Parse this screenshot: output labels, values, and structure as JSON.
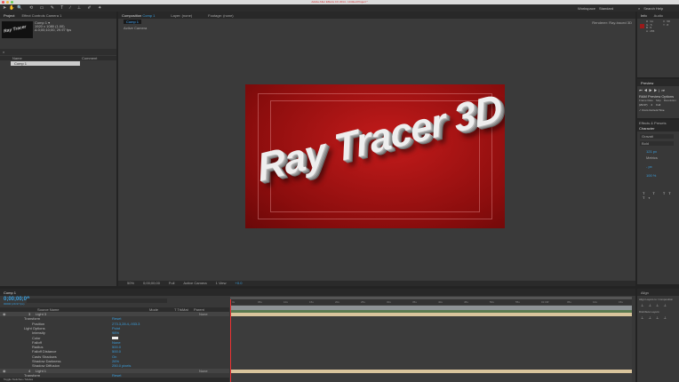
{
  "window": {
    "title": "Adobe After Effects CC 2014 - Untitled Project *"
  },
  "workspace": {
    "label": "Workspace",
    "value": "Standard",
    "search_placeholder": "Search Help"
  },
  "project": {
    "tab": "Project",
    "effect_controls_tab": "Effect Controls Camera 1",
    "comp_name": "Comp 1 ▾",
    "comp_info_1": "1920 x 1080 (1.00)",
    "comp_info_2": "Δ 0;00;10;00, 29.97 fps",
    "thumb_text": "Ray Tracer",
    "col_name": "Name",
    "col_comment": "Comment",
    "item": "Comp 1"
  },
  "composition": {
    "tab_prefix": "Composition",
    "tab_comp": "Comp 1",
    "layer_tab": "Layer: (none)",
    "footage_tab": "Footage: (none)",
    "comp_chip": "Comp 1",
    "camera_label": "Active Camera",
    "renderer_label": "Renderer:",
    "renderer_value": "Ray-traced 3D",
    "title_text": "Ray Tracer 3D",
    "footer": {
      "zoom": "50%",
      "timecode": "0;00;00;00",
      "resolution": "Full",
      "camera": "Active Camera",
      "view": "1 View",
      "exposure": "+0.0"
    }
  },
  "info": {
    "tab": "Info",
    "audio_tab": "Audio",
    "r": "R : 91",
    "g": "G : 5",
    "b": "B : 5",
    "a": "A : 255",
    "x": "X : 58",
    "y": "Y : 8",
    "swatch": "#9a1a1a"
  },
  "preview": {
    "tab": "Preview",
    "ram_options": "RAM Preview Options",
    "frame_rate_label": "Frame Rate",
    "skip_label": "Skip",
    "resolution_label": "Resolution",
    "frame_rate": "(29.97)",
    "skip": "2",
    "resolution": "Full",
    "from_current": "From Current Time"
  },
  "effects": {
    "tab": "Effects & Presets",
    "char_tab": "Character",
    "font": "Gravati",
    "style": "Bold",
    "size": "121 px",
    "tracking": "Metrics",
    "leading": "- px",
    "scale": "100 %"
  },
  "align": {
    "tab": "Align",
    "align_label": "Align Layers to:",
    "align_to": "Composition",
    "distribute_label": "Distribute Layers:"
  },
  "timeline": {
    "tab": "Comp 1",
    "timecode": "0;00;00;00",
    "fps": "00000 (29.97 fps)",
    "headers": {
      "source_name": "Source Name",
      "mode": "Mode",
      "trkmat": "T TrkMat",
      "parent": "Parent"
    },
    "rows": [
      {
        "indent": 0,
        "num": "3",
        "name": "Light 3",
        "value": "",
        "parent": "None",
        "layer": true
      },
      {
        "indent": 1,
        "name": "Transform",
        "value": "Reset"
      },
      {
        "indent": 2,
        "name": "Position",
        "value": "273.3,28.4,-933.3"
      },
      {
        "indent": 1,
        "name": "Light Options",
        "value": "Point"
      },
      {
        "indent": 2,
        "name": "Intensity",
        "value": "98%"
      },
      {
        "indent": 2,
        "name": "Color",
        "value": ""
      },
      {
        "indent": 2,
        "name": "Falloff",
        "value": "None"
      },
      {
        "indent": 2,
        "name": "Radius",
        "value": "500.0"
      },
      {
        "indent": 2,
        "name": "Falloff Distance",
        "value": "500.0"
      },
      {
        "indent": 2,
        "name": "Casts Shadows",
        "value": "On"
      },
      {
        "indent": 2,
        "name": "Shadow Darkness",
        "value": "26%"
      },
      {
        "indent": 2,
        "name": "Shadow Diffusion",
        "value": "250.0 pixels"
      },
      {
        "indent": 0,
        "num": "4",
        "name": "Light 1",
        "value": "",
        "parent": "None",
        "layer": true
      },
      {
        "indent": 1,
        "name": "Transform",
        "value": "Reset"
      }
    ],
    "ruler": [
      "0s",
      "05s",
      "10s",
      "15s",
      "20s",
      "25s",
      "30s",
      "35s",
      "40s",
      "45s",
      "50s",
      "55s",
      "01:00f",
      "05s",
      "10s",
      "15s"
    ],
    "footer_label": "Toggle Switches / Modes"
  }
}
